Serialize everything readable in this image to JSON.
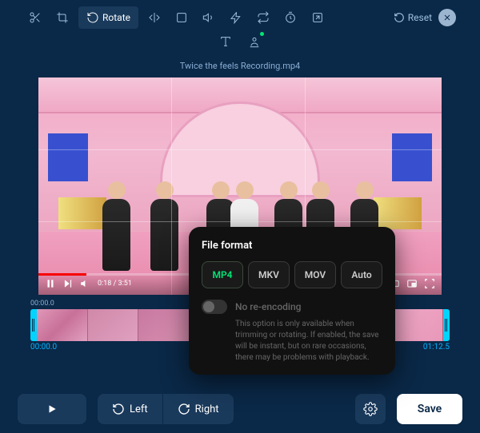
{
  "toolbar": {
    "rotate_label": "Rotate",
    "reset_label": "Reset"
  },
  "filename": "Twice the feels Recording.mp4",
  "video": {
    "current_time": "0:18 / 3:51"
  },
  "timeline": {
    "tooltip_time": "00:00.0",
    "start_time": "00:00.0",
    "end_time": "01:12.5"
  },
  "popup": {
    "title": "File format",
    "formats": [
      "MP4",
      "MKV",
      "MOV",
      "Auto"
    ],
    "selected_format": "MP4",
    "toggle_label": "No re-encoding",
    "toggle_desc": "This option is only available when trimming or rotating. If enabled, the save will be instant, but on rare occasions, there may be problems with playback."
  },
  "bottom": {
    "left_label": "Left",
    "right_label": "Right",
    "save_label": "Save"
  }
}
